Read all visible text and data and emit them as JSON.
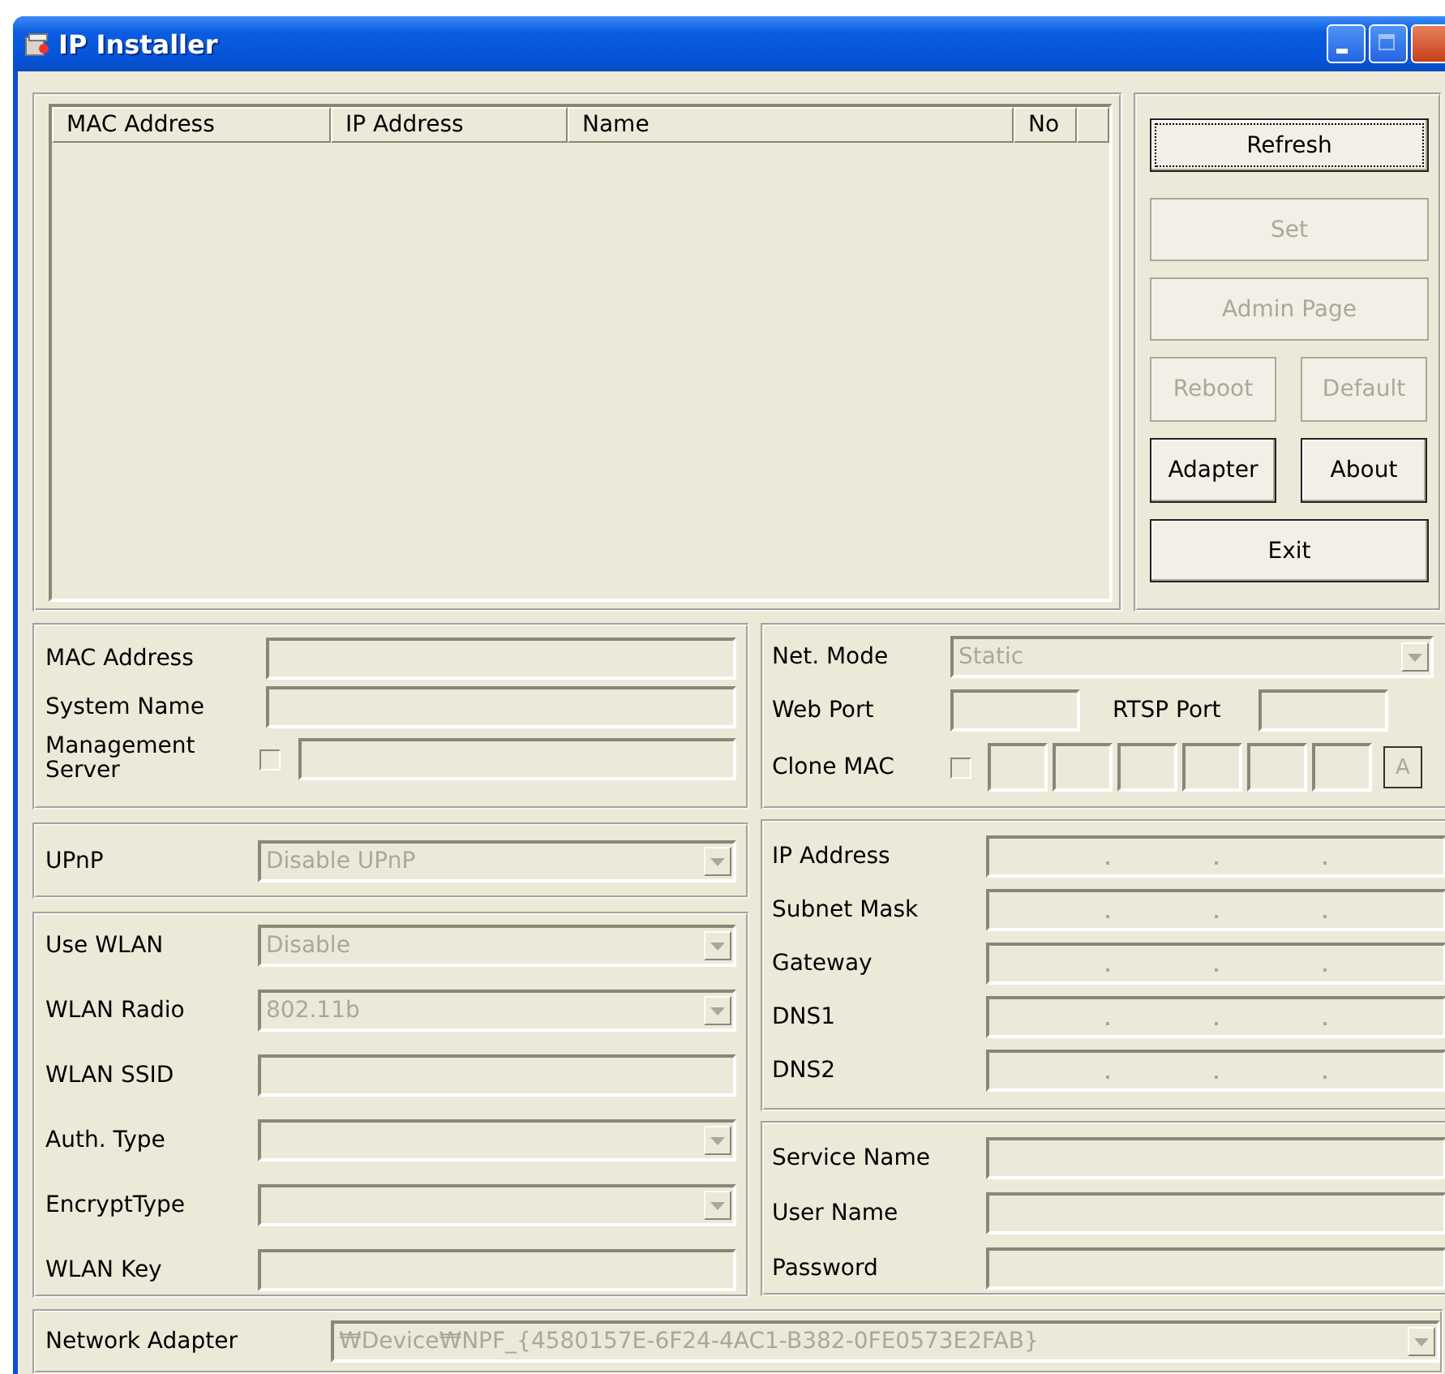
{
  "window": {
    "title": "IP Installer"
  },
  "device_list": {
    "columns": [
      "MAC Address",
      "IP Address",
      "Name",
      "No"
    ]
  },
  "buttons": [
    {
      "label": "Refresh",
      "kind": "wide",
      "disabled": false,
      "focused": true
    },
    {
      "label": "Set",
      "kind": "wide",
      "disabled": true,
      "focused": false
    },
    {
      "label": "Admin Page",
      "kind": "wide",
      "disabled": true,
      "focused": false
    },
    {
      "label": "Reboot",
      "kind": "half",
      "disabled": true,
      "focused": false
    },
    {
      "label": "Default",
      "kind": "half",
      "disabled": true,
      "focused": false
    },
    {
      "label": "Adapter",
      "kind": "half",
      "disabled": false,
      "focused": false
    },
    {
      "label": "About",
      "kind": "half",
      "disabled": false,
      "focused": false
    },
    {
      "label": "Exit",
      "kind": "wide",
      "disabled": false,
      "focused": false
    }
  ],
  "device_info": {
    "rows": [
      {
        "kind": "text",
        "label": "MAC Address"
      },
      {
        "kind": "text",
        "label": "System Name"
      },
      {
        "kind": "check_text",
        "label": "Management Server",
        "checked": false
      }
    ]
  },
  "network": {
    "rows": [
      {
        "kind": "select",
        "label": "Net. Mode",
        "value": "Static",
        "disabled": true
      },
      {
        "kind": "ports",
        "label": "Web Port",
        "label2": "RTSP Port"
      },
      {
        "kind": "mac",
        "label": "Clone MAC",
        "checked": false,
        "button": {
          "label": "A",
          "disabled": true
        }
      }
    ]
  },
  "upnp": {
    "rows": [
      {
        "kind": "select",
        "label": "UPnP",
        "value": "Disable UPnP",
        "disabled": true
      }
    ]
  },
  "wlan": {
    "rows": [
      {
        "kind": "select",
        "label": "Use WLAN",
        "value": "Disable",
        "disabled": true
      },
      {
        "kind": "select",
        "label": "WLAN Radio",
        "value": "802.11b",
        "disabled": true
      },
      {
        "kind": "text",
        "label": "WLAN SSID"
      },
      {
        "kind": "select",
        "label": "Auth. Type",
        "disabled": true
      },
      {
        "kind": "select",
        "label": "EncryptType",
        "disabled": true
      },
      {
        "kind": "text",
        "label": "WLAN Key"
      }
    ]
  },
  "ip_settings": {
    "rows": [
      {
        "kind": "ip",
        "label": "IP Address"
      },
      {
        "kind": "ip",
        "label": "Subnet Mask"
      },
      {
        "kind": "ip",
        "label": "Gateway"
      },
      {
        "kind": "ip",
        "label": "DNS1"
      },
      {
        "kind": "ip",
        "label": "DNS2"
      }
    ]
  },
  "service": {
    "rows": [
      {
        "kind": "text",
        "label": "Service Name"
      },
      {
        "kind": "text",
        "label": "User Name"
      },
      {
        "kind": "text",
        "label": "Password"
      }
    ]
  },
  "adapter": {
    "rows": [
      {
        "kind": "select",
        "label": "Network Adapter",
        "value": "₩Device₩NPF_{4580157E-6F24-4AC1-B382-0FE0573E2FAB}",
        "disabled": true
      }
    ]
  }
}
